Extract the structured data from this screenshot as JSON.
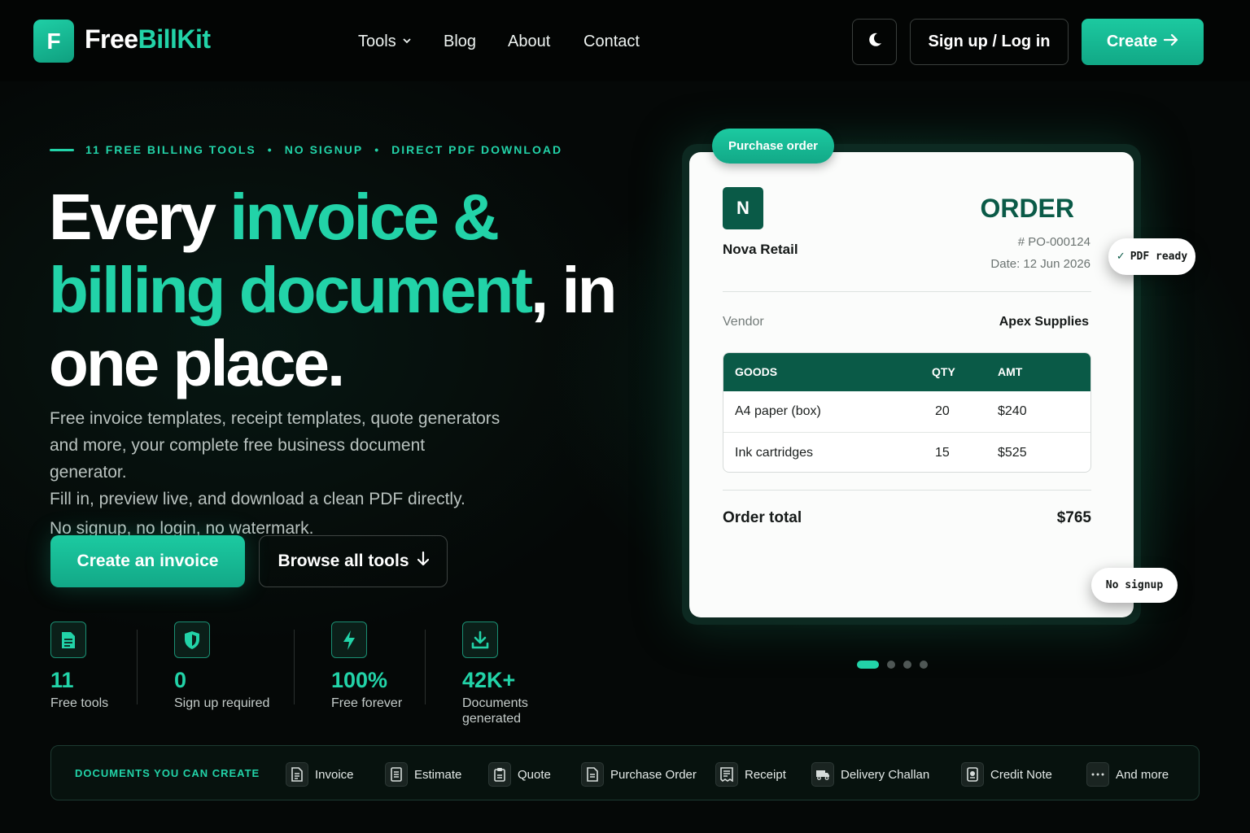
{
  "brand": {
    "logo_letter": "F",
    "name_white": "Free",
    "name_green": "BillKit",
    "accent": "#22d3a8",
    "dark_green": "#0a5a47"
  },
  "nav": {
    "links": [
      "Tools",
      "Blog",
      "About",
      "Contact"
    ],
    "theme_icon": "moon-icon",
    "login_label": "Sign up / Log in",
    "create_label": "Create"
  },
  "hero": {
    "eyebrow": [
      "11 FREE BILLING TOOLS",
      "NO SIGNUP",
      "DIRECT PDF DOWNLOAD"
    ],
    "headline": {
      "part1": "Every ",
      "part2": "invoice &",
      "part3": "billing document",
      "part4": ", in",
      "part5": "one place."
    },
    "sub_lines": [
      "Free invoice templates, receipt templates, quote generators",
      "and more, your complete free business document generator.",
      "Fill in, preview live, and download a clean PDF directly."
    ],
    "sub_last": "No signup, no login, no watermark.",
    "cta_primary": "Create an invoice",
    "cta_secondary": "Browse all tools"
  },
  "stats": [
    {
      "icon": "document-icon",
      "value": "11",
      "label": "Free tools"
    },
    {
      "icon": "shield-icon",
      "value": "0",
      "label": "Sign up required"
    },
    {
      "icon": "lightning-icon",
      "value": "100%",
      "label": "Free forever"
    },
    {
      "icon": "download-icon",
      "value": "42K+",
      "label_line1": "Documents",
      "label_line2": "generated"
    }
  ],
  "preview": {
    "tag": "Purchase order",
    "company_initial": "N",
    "company_name": "Nova Retail",
    "doc_title": "ORDER",
    "po_number": "# PO-000124",
    "date": "Date: 12 Jun 2026",
    "vendor_label": "Vendor",
    "vendor_value": "Apex Supplies",
    "table": {
      "headers": [
        "GOODS",
        "QTY",
        "AMT"
      ],
      "rows": [
        [
          "A4 paper (box)",
          "20",
          "$240"
        ],
        [
          "Ink cartridges",
          "15",
          "$525"
        ]
      ]
    },
    "total_label": "Order total",
    "total_value": "$765",
    "pill_pdf": "PDF ready",
    "pill_nosign": "No signup",
    "carousel_active": 0,
    "carousel_count": 4
  },
  "strip": {
    "label": "DOCUMENTS YOU CAN CREATE",
    "items": [
      "Invoice",
      "Estimate",
      "Quote",
      "Purchase Order",
      "Receipt",
      "Delivery Challan",
      "Credit Note",
      "And more"
    ]
  }
}
